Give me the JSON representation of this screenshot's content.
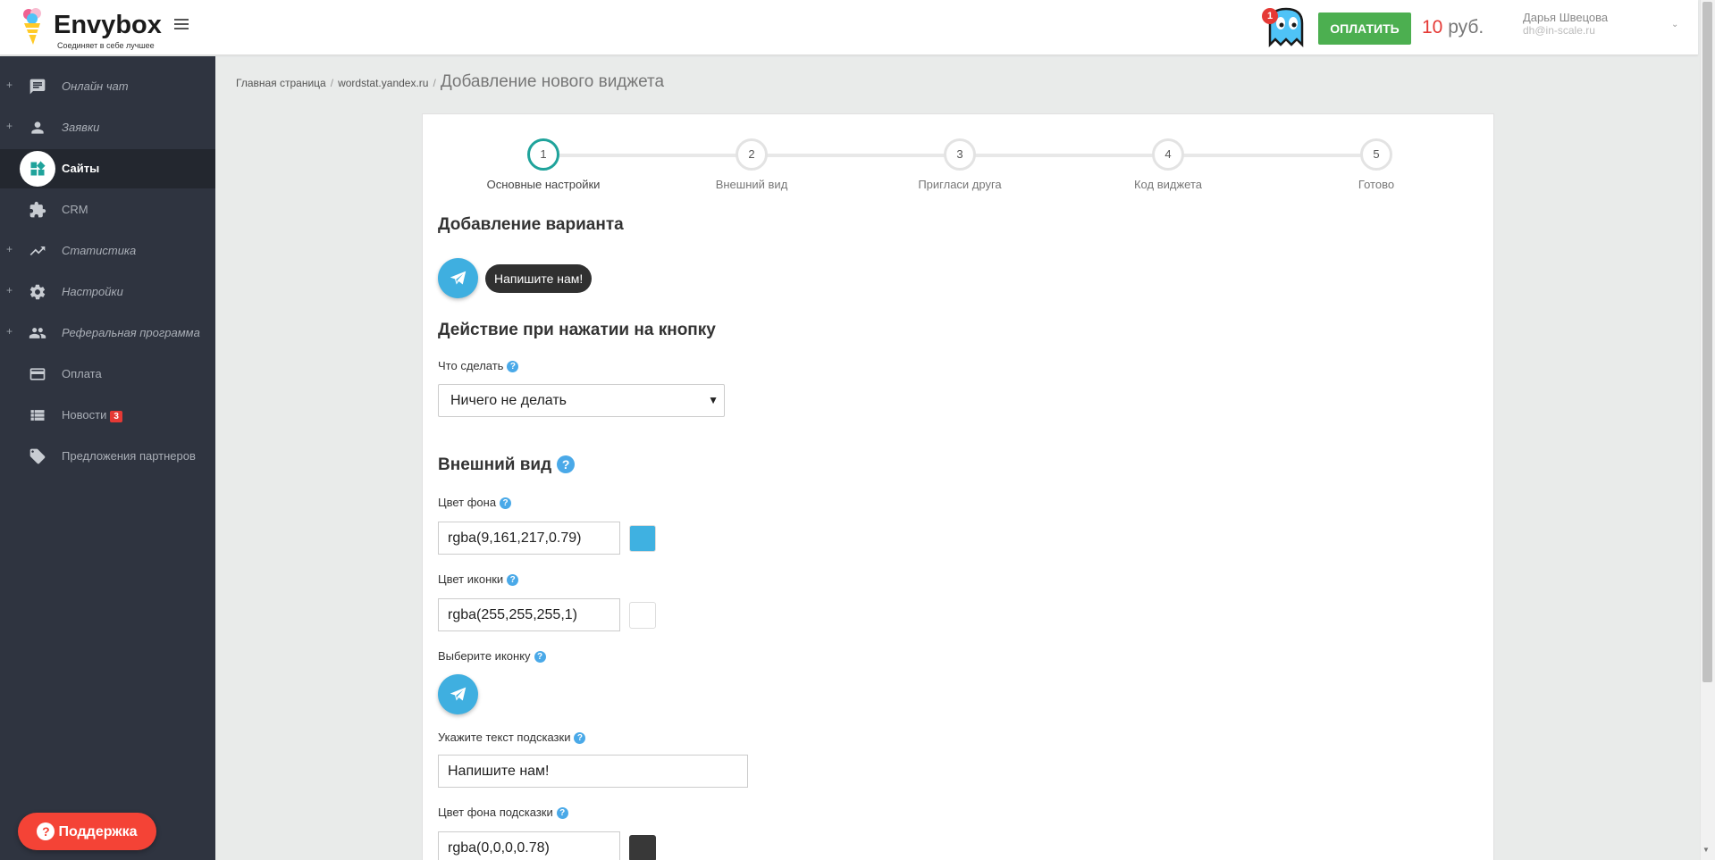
{
  "header": {
    "logo_name": "Envybox",
    "logo_tagline": "Соединяет в себе лучшее",
    "notif_count": "1",
    "pay_button": "ОПЛАТИТЬ",
    "balance_amount": "10",
    "balance_currency": "руб.",
    "user_name": "Дарья Швецова",
    "user_email": "dh@in-scale.ru"
  },
  "sidebar": {
    "items": [
      {
        "label": "Онлайн чат",
        "icon": "chat-icon"
      },
      {
        "label": "Заявки",
        "icon": "person-icon"
      },
      {
        "label": "Сайты",
        "icon": "widgets-icon",
        "active": true
      },
      {
        "label": "CRM",
        "icon": "puzzle-icon"
      },
      {
        "label": "Статистика",
        "icon": "trending-up-icon"
      },
      {
        "label": "Настройки",
        "icon": "gear-icon"
      },
      {
        "label": "Реферальная программа",
        "icon": "people-icon"
      },
      {
        "label": "Оплата",
        "icon": "credit-card-icon"
      },
      {
        "label": "Новости",
        "icon": "list-icon",
        "badge": "3"
      },
      {
        "label": "Предложения партнеров",
        "icon": "tag-icon"
      }
    ],
    "support_label": "Поддержка"
  },
  "breadcrumb": {
    "home": "Главная страница",
    "site": "wordstat.yandex.ru",
    "current": "Добавление нового виджета"
  },
  "steps": [
    {
      "num": "1",
      "label": "Основные настройки",
      "active": true
    },
    {
      "num": "2",
      "label": "Внешний вид"
    },
    {
      "num": "3",
      "label": "Пригласи друга"
    },
    {
      "num": "4",
      "label": "Код виджета"
    },
    {
      "num": "5",
      "label": "Готово"
    }
  ],
  "form": {
    "variant_title": "Добавление варианта",
    "preview_tooltip": "Напишите нам!",
    "action_title": "Действие при нажатии на кнопку",
    "action_label": "Что сделать",
    "action_value": "Ничего не делать",
    "appearance_title": "Внешний вид",
    "bg_color_label": "Цвет фона",
    "bg_color_value": "rgba(9,161,217,0.79)",
    "icon_color_label": "Цвет иконки",
    "icon_color_value": "rgba(255,255,255,1)",
    "choose_icon_label": "Выберите иконку",
    "hint_text_label": "Укажите текст подсказки",
    "hint_text_value": "Напишите нам!",
    "hint_bg_label": "Цвет фона подсказки",
    "hint_bg_value": "rgba(0,0,0,0.78)"
  },
  "colors": {
    "accent_green": "#4caf50",
    "step_active": "#1fa39b",
    "swatch_bg": "#3fb1e1",
    "swatch_icon": "#ffffff",
    "swatch_hint_bg": "#383838",
    "support_red": "#f44336"
  }
}
